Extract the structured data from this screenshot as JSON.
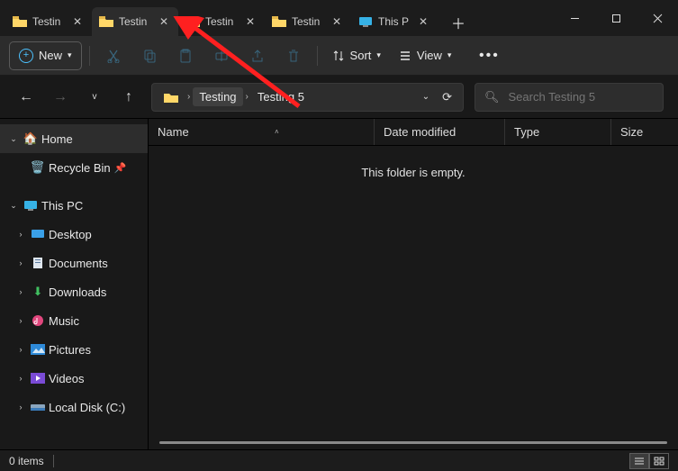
{
  "tabs": [
    {
      "label": "Testin",
      "active": false,
      "icon": "folder"
    },
    {
      "label": "Testin",
      "active": true,
      "icon": "folder"
    },
    {
      "label": "Testin",
      "active": false,
      "icon": "folder"
    },
    {
      "label": "Testin",
      "active": false,
      "icon": "folder"
    },
    {
      "label": "This P",
      "active": false,
      "icon": "pc"
    }
  ],
  "toolbar": {
    "new_label": "New",
    "sort_label": "Sort",
    "view_label": "View"
  },
  "breadcrumb": {
    "segments": [
      "Testing",
      "Testing 5"
    ]
  },
  "search": {
    "placeholder": "Search Testing 5"
  },
  "sidebar": {
    "home": "Home",
    "recycle": "Recycle Bin",
    "this_pc": "This PC",
    "desktop": "Desktop",
    "documents": "Documents",
    "downloads": "Downloads",
    "music": "Music",
    "pictures": "Pictures",
    "videos": "Videos",
    "local_c": "Local Disk (C:)"
  },
  "columns": {
    "name": "Name",
    "date": "Date modified",
    "type": "Type",
    "size": "Size"
  },
  "content": {
    "empty_message": "This folder is empty."
  },
  "status": {
    "item_count": "0 items"
  }
}
